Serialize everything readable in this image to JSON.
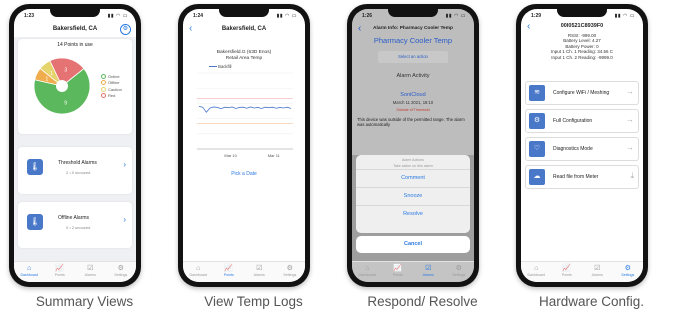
{
  "captions": [
    "Summary Views",
    "View Temp Logs",
    "Respond/ Resolve",
    "Hardware Config."
  ],
  "tabs": [
    "Dashboard",
    "Points",
    "Alarms",
    "Settings"
  ],
  "phone1": {
    "time": "1:23",
    "title": "Bakersfield, CA",
    "points_in_use": "14 Points in use",
    "pie": {
      "type": "pie",
      "values": [
        9,
        1,
        1,
        3
      ],
      "labels": [
        "Online",
        "Offline",
        "Caution",
        "Red"
      ],
      "value_labels": [
        "9",
        "1",
        "1",
        "3"
      ],
      "colors": [
        "#5cb85c",
        "#f0ad4e",
        "#e5d36c",
        "#e57373"
      ]
    },
    "threshold_alarms": {
      "title": "Threshold Alarms",
      "sub": "2 • 0 snoozed"
    },
    "offline_alarms": {
      "title": "Offline Alarms",
      "sub": "0 • 2 snoozed"
    }
  },
  "phone2": {
    "time": "1:24",
    "title": "Bakersfield, CA",
    "chart_title_1": "Bakersfield.G (63D Enos)",
    "chart_title_2": "Retail Area Temp",
    "legend": "Backfill",
    "x_ticks": [
      "Mar 10",
      "Mar 11"
    ],
    "pick_date": "Pick a Date",
    "chart_data": {
      "type": "line",
      "series": [
        {
          "name": "Backfill",
          "values": [
            71.8,
            71.5,
            69.5,
            71.2,
            71.6,
            71.4,
            70.9,
            71.5,
            71.3,
            71.6,
            71.0,
            71.4,
            71.5,
            71.1,
            71.6,
            71.2,
            71.4,
            71.0,
            71.5,
            71.3,
            71.5,
            71.1,
            71.4,
            71.2,
            71.5,
            71.0
          ]
        }
      ],
      "upper_threshold": 75,
      "lower_threshold": 65
    }
  },
  "phone3": {
    "time": "1:26",
    "nav_title": "Alarm Info: Pharmacy Cooler Temp",
    "heading": "Pharmacy Cooler Temp",
    "select_action": "Select an action",
    "alarm_activity": "Alarm Activity",
    "sonicloud": "SoniCloud",
    "date": "March 11 2021, 18:10",
    "status": "Outside of Threshold",
    "description": "This device was outside of the permitted range. The alarm was automatically",
    "sheet_title": "Alarm Actions",
    "sheet_subtitle": "Take action on this alarm",
    "options": [
      "Comment",
      "Snooze",
      "Resolve"
    ],
    "cancel": "Cancel"
  },
  "phone4": {
    "time": "1:29",
    "title": "00I0521C8939F0",
    "info_lines": [
      "RSSI: -999.00",
      "Battery Level: 4.27",
      "Battery Power: 0",
      "Input 1 Ch. 1 Reading: 34.56 C",
      "Input 1 Ch. 2 Reading: -9999.0"
    ],
    "buttons": [
      "Configure WiFi / Meshing",
      "Full Configuration",
      "Diagnostics Mode",
      "Read file from Meter"
    ]
  }
}
